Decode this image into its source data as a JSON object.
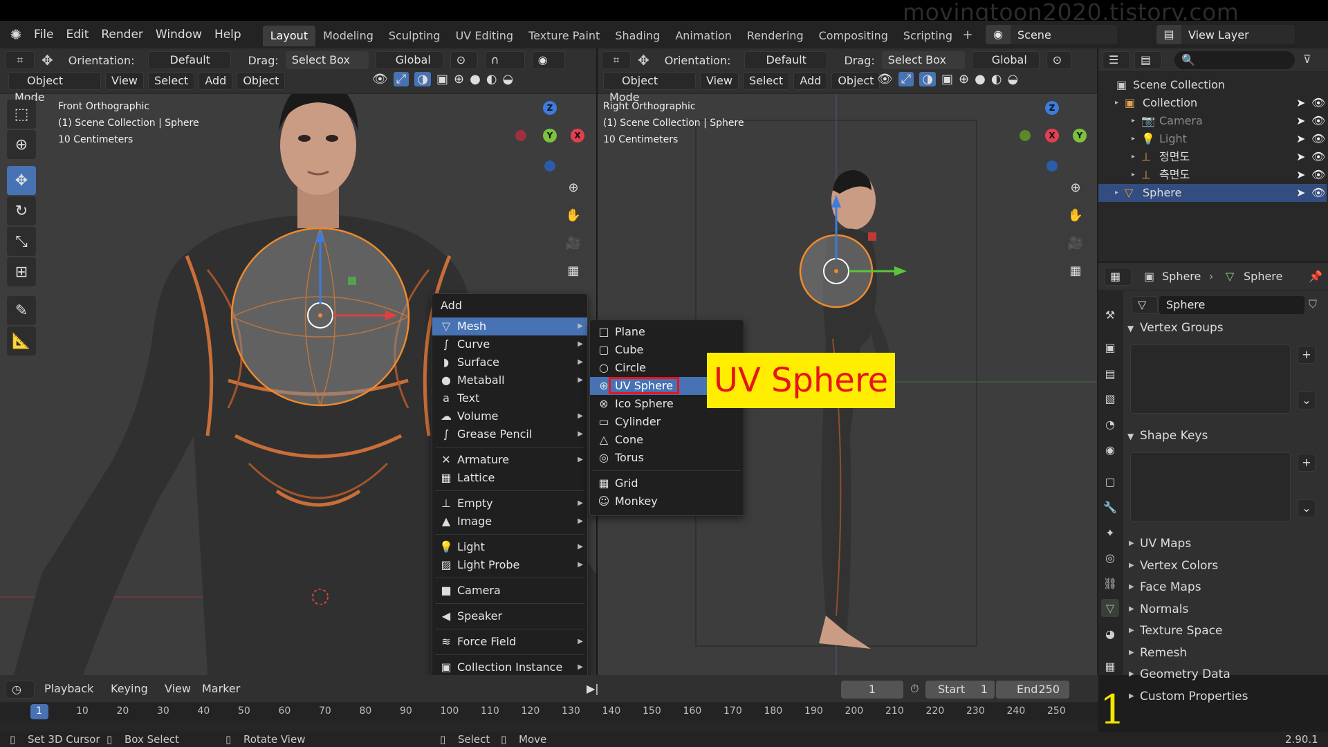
{
  "watermark": "movingtoon2020.tistory.com",
  "menubar": {
    "items": [
      "File",
      "Edit",
      "Render",
      "Window",
      "Help"
    ],
    "workspaces": [
      "Layout",
      "Modeling",
      "Sculpting",
      "UV Editing",
      "Texture Paint",
      "Shading",
      "Animation",
      "Rendering",
      "Compositing",
      "Scripting"
    ],
    "active_workspace": "Layout",
    "plus": "+",
    "scene_label": "Scene",
    "view_layer_label": "View Layer"
  },
  "left_viewport": {
    "orientation_label": "Orientation:",
    "orientation_value": "Default",
    "drag_label": "Drag:",
    "drag_value": "Select Box",
    "transform_value": "Global",
    "mode": "Object Mode",
    "menus": [
      "View",
      "Select",
      "Add",
      "Object"
    ],
    "info_line1": "Front Orthographic",
    "info_line2": "(1) Scene Collection | Sphere",
    "info_line3": "10 Centimeters",
    "gizmo_z": "Z",
    "gizmo_y": "Y",
    "gizmo_x": "X"
  },
  "right_viewport": {
    "orientation_label": "Orientation:",
    "orientation_value": "Default",
    "drag_label": "Drag:",
    "drag_value": "Select Box",
    "transform_value": "Global",
    "mode": "Object Mode",
    "menus": [
      "View",
      "Select",
      "Add",
      "Object"
    ],
    "info_line1": "Right Orthographic",
    "info_line2": "(1) Scene Collection | Sphere",
    "info_line3": "10 Centimeters",
    "gizmo_z": "Z",
    "gizmo_x": "X",
    "gizmo_y": "Y"
  },
  "add_menu": {
    "title": "Add",
    "groups": [
      [
        {
          "label": "Mesh",
          "icon": "mesh-icon",
          "glyph": "▽",
          "submenu": true,
          "highlighted": true
        },
        {
          "label": "Curve",
          "icon": "curve-icon",
          "glyph": "∫",
          "submenu": true
        },
        {
          "label": "Surface",
          "icon": "surface-icon",
          "glyph": "◗",
          "submenu": true
        },
        {
          "label": "Metaball",
          "icon": "metaball-icon",
          "glyph": "●",
          "submenu": true
        },
        {
          "label": "Text",
          "icon": "text-icon",
          "glyph": "a",
          "submenu": false
        },
        {
          "label": "Volume",
          "icon": "volume-icon",
          "glyph": "☁",
          "submenu": true
        },
        {
          "label": "Grease Pencil",
          "icon": "grease-pencil-icon",
          "glyph": "∫",
          "submenu": true
        }
      ],
      [
        {
          "label": "Armature",
          "icon": "armature-icon",
          "glyph": "✕",
          "submenu": true
        },
        {
          "label": "Lattice",
          "icon": "lattice-icon",
          "glyph": "▦",
          "submenu": false
        }
      ],
      [
        {
          "label": "Empty",
          "icon": "empty-icon",
          "glyph": "⊥",
          "submenu": true
        },
        {
          "label": "Image",
          "icon": "image-icon",
          "glyph": "▲",
          "submenu": true
        }
      ],
      [
        {
          "label": "Light",
          "icon": "light-icon",
          "glyph": "💡",
          "submenu": true
        },
        {
          "label": "Light Probe",
          "icon": "light-probe-icon",
          "glyph": "▨",
          "submenu": true
        }
      ],
      [
        {
          "label": "Camera",
          "icon": "camera-icon",
          "glyph": "■",
          "submenu": false
        }
      ],
      [
        {
          "label": "Speaker",
          "icon": "speaker-icon",
          "glyph": "◀",
          "submenu": false
        }
      ],
      [
        {
          "label": "Force Field",
          "icon": "force-field-icon",
          "glyph": "≋",
          "submenu": true
        }
      ],
      [
        {
          "label": "Collection Instance",
          "icon": "collection-instance-icon",
          "glyph": "▣",
          "submenu": true
        }
      ]
    ]
  },
  "mesh_submenu": {
    "groups": [
      [
        {
          "label": "Plane",
          "icon": "plane-icon",
          "glyph": "□"
        },
        {
          "label": "Cube",
          "icon": "cube-icon",
          "glyph": "▢"
        },
        {
          "label": "Circle",
          "icon": "circle-icon",
          "glyph": "○"
        },
        {
          "label": "UV Sphere",
          "icon": "uv-sphere-icon",
          "glyph": "⊕",
          "highlighted": true
        },
        {
          "label": "Ico Sphere",
          "icon": "ico-sphere-icon",
          "glyph": "⊗"
        },
        {
          "label": "Cylinder",
          "icon": "cylinder-icon",
          "glyph": "▭"
        },
        {
          "label": "Cone",
          "icon": "cone-icon",
          "glyph": "△"
        },
        {
          "label": "Torus",
          "icon": "torus-icon",
          "glyph": "◎"
        }
      ],
      [
        {
          "label": "Grid",
          "icon": "grid-icon",
          "glyph": "▦"
        },
        {
          "label": "Monkey",
          "icon": "monkey-icon",
          "glyph": "☺"
        }
      ]
    ]
  },
  "callout": {
    "text": "UV Sphere",
    "bg": "#ffee00",
    "fg": "#e8141c"
  },
  "outliner": {
    "root": "Scene Collection",
    "items": [
      {
        "label": "Collection",
        "indent": 1,
        "icon": "collection-icon"
      },
      {
        "label": "Camera",
        "indent": 2,
        "icon": "camera-icon",
        "dim": true
      },
      {
        "label": "Light",
        "indent": 2,
        "icon": "light-icon",
        "dim": true
      },
      {
        "label": "정면도",
        "indent": 2,
        "icon": "empty-image-icon"
      },
      {
        "label": "측면도",
        "indent": 2,
        "icon": "empty-image-icon"
      },
      {
        "label": "Sphere",
        "indent": 1,
        "icon": "mesh-object-icon",
        "selected": true
      }
    ]
  },
  "properties": {
    "breadcrumb_object": "Sphere",
    "breadcrumb_data": "Sphere",
    "data_name": "Sphere",
    "panels_open": [
      "Vertex Groups",
      "Shape Keys"
    ],
    "panels_closed": [
      "UV Maps",
      "Vertex Colors",
      "Face Maps",
      "Normals",
      "Texture Space",
      "Remesh",
      "Geometry Data",
      "Custom Properties"
    ]
  },
  "timeline": {
    "playback": "Playback",
    "keying": "Keying",
    "view": "View",
    "marker": "Marker",
    "current_frame": "1",
    "start_label": "Start",
    "start_value": "1",
    "end_label": "End",
    "end_value": "250",
    "ruler": [
      "1",
      "10",
      "20",
      "30",
      "40",
      "50",
      "60",
      "70",
      "80",
      "90",
      "100",
      "110",
      "120",
      "130",
      "140",
      "150",
      "160",
      "170",
      "180",
      "190",
      "200",
      "210",
      "220",
      "230",
      "240",
      "250"
    ]
  },
  "statusbar": {
    "items": [
      "Set 3D Cursor",
      "Box Select",
      "Rotate View",
      "Select",
      "Move"
    ],
    "version": "2.90.1",
    "overlay_number": "1"
  },
  "colors": {
    "accent": "#4772b3",
    "selected_orange": "#f08a2c",
    "red_box": "#e8141c"
  }
}
